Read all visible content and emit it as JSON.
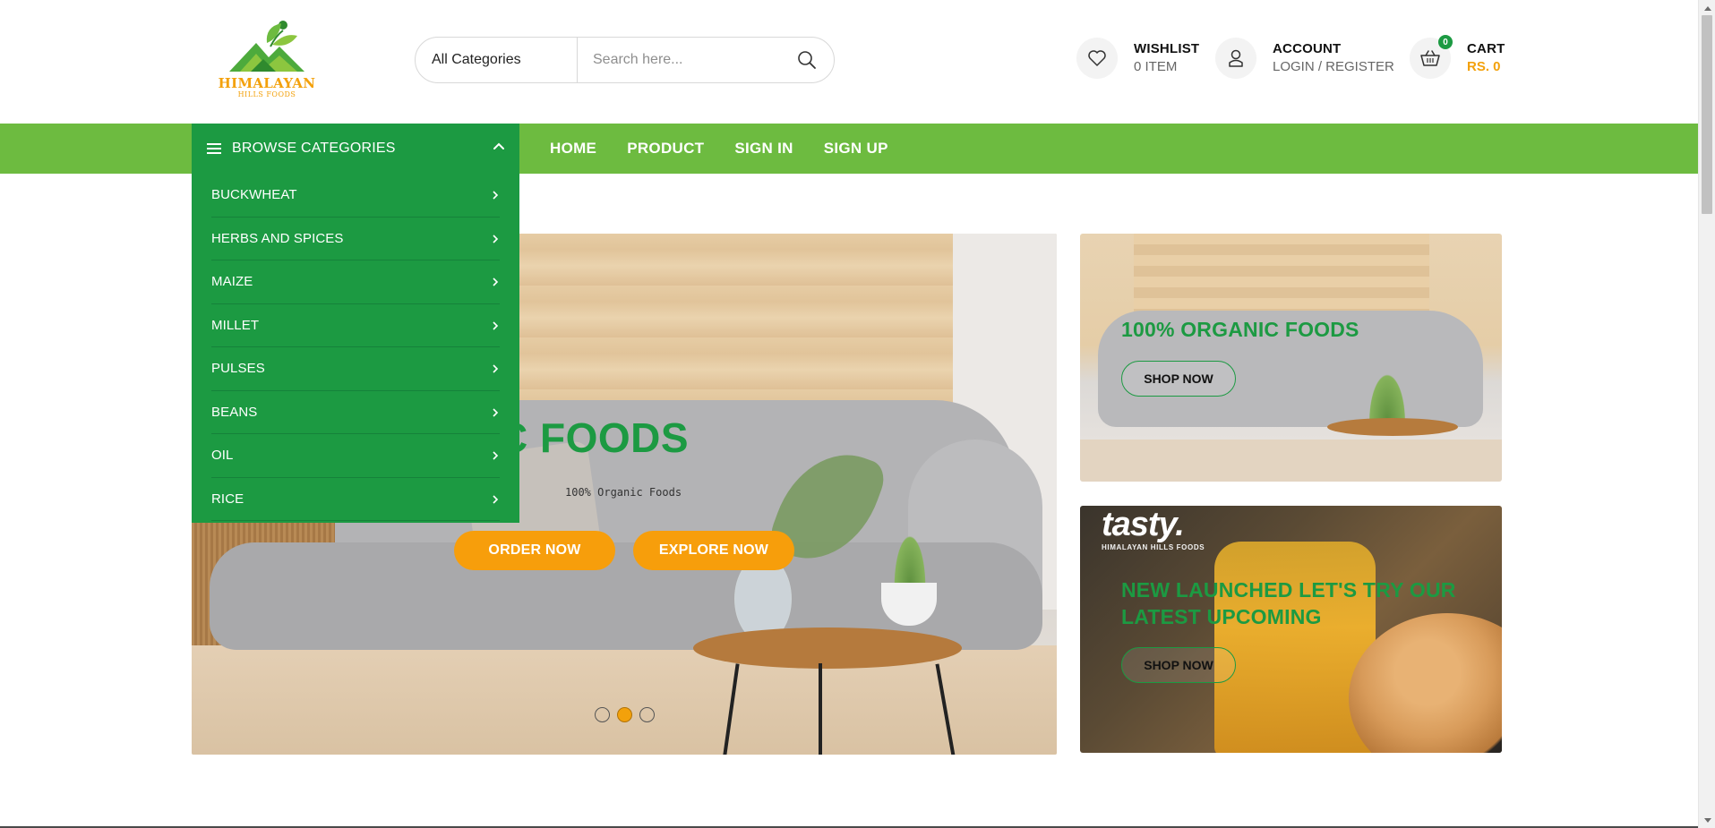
{
  "logo": {
    "name": "HIMALAYAN",
    "sub": "HILLS FOODS"
  },
  "search": {
    "category": "All Categories",
    "placeholder": "Search here..."
  },
  "header": {
    "wishlist": {
      "title": "WISHLIST",
      "sub": "0 ITEM"
    },
    "account": {
      "title": "ACCOUNT",
      "sub": "LOGIN / REGISTER"
    },
    "cart": {
      "title": "CART",
      "total": "RS. 0",
      "count": "0"
    }
  },
  "browse": {
    "label": "BROWSE CATEGORIES"
  },
  "categories": [
    "BUCKWHEAT",
    "HERBS AND SPICES",
    "MAIZE",
    "MILLET",
    "PULSES",
    "BEANS",
    "OIL",
    "RICE"
  ],
  "nav": [
    "HOME",
    "PRODUCT",
    "SIGN IN",
    "SIGN UP"
  ],
  "hero": {
    "title": "ORGANIC FOODS",
    "subtitle": "100% Organic Foods",
    "order_label": "ORDER NOW",
    "explore_label": "EXPLORE NOW",
    "slide_count": 3,
    "active_slide": 2
  },
  "banner1": {
    "title": "100% ORGANIC FOODS",
    "button": "SHOP NOW"
  },
  "banner2": {
    "brand": "tasty.",
    "brand_sub": "HIMALAYAN HILLS FOODS",
    "title_line1": "NEW LAUNCHED LET'S TRY OUR",
    "title_line2": "LATEST UPCOMING",
    "button": "SHOP NOW"
  },
  "colors": {
    "primary_green": "#1c9a42",
    "nav_green": "#6dbb40",
    "accent_orange": "#f79e0b"
  },
  "icons": {
    "search": "search-icon",
    "wishlist": "heart-icon",
    "account": "user-icon",
    "cart": "basket-icon",
    "menu": "hamburger-icon",
    "collapse": "chevron-up-icon",
    "category_arrow": "chevron-right-icon"
  }
}
